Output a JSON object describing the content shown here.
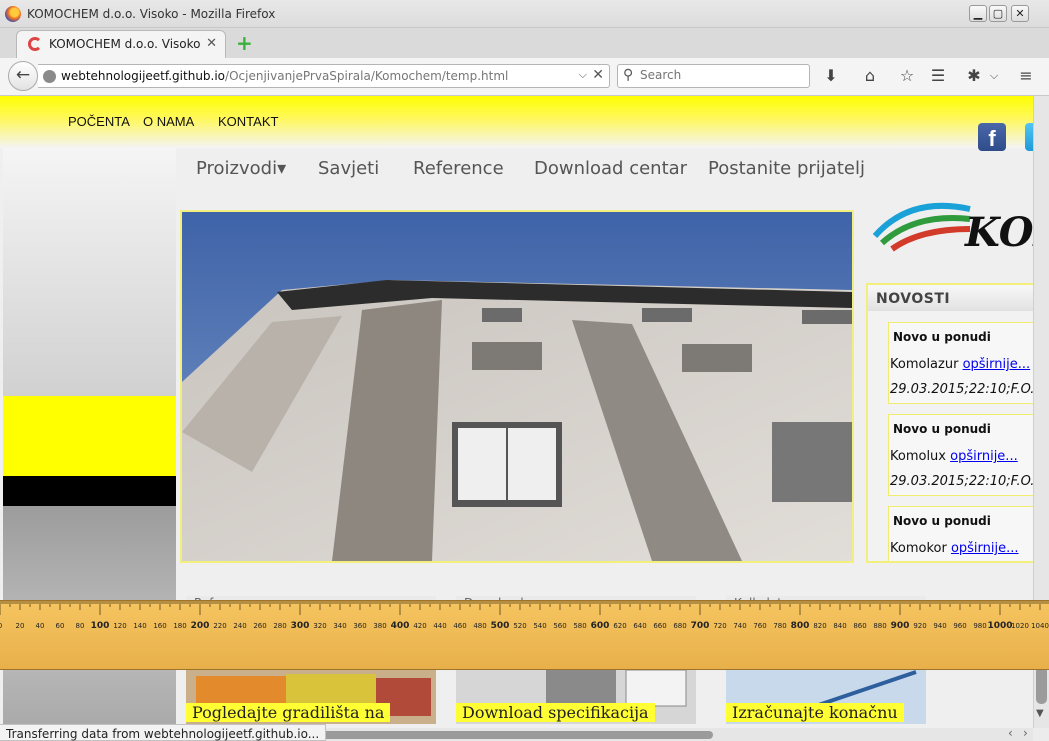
{
  "browser": {
    "window_title": "KOMOCHEM d.o.o. Visoko - Mozilla Firefox",
    "tab_title": "KOMOCHEM d.o.o. Visoko",
    "url_host": "webtehnologijeetf.github.io",
    "url_path": "/OcjenjivanjePrvaSpirala/Komochem/temp.html",
    "search_placeholder": "Search",
    "status_text": "Transferring data from webtehnologijeetf.github.io...",
    "icons": [
      "firefox-logo",
      "back-arrow",
      "globe",
      "download-arrow",
      "home",
      "star",
      "reading-list",
      "extensions",
      "menu"
    ]
  },
  "site": {
    "top_nav": [
      "POČENTA",
      "O NAMA",
      "KONTAKT"
    ],
    "main_nav": [
      "Proizvodi",
      "Savjeti",
      "Reference",
      "Download centar",
      "Postanite prijatelj"
    ],
    "dropdown_glyph": "▾",
    "news": {
      "heading": "NOVOSTI",
      "items": [
        {
          "title": "Novo u ponudi",
          "product": "Komolazur",
          "link": "opširnije...",
          "date": "29.03.2015;22:10;F.O."
        },
        {
          "title": "Novo u ponudi",
          "product": "Komolux",
          "link": "opširnije...",
          "date": "29.03.2015;22:10;F.O."
        },
        {
          "title": "Novo u ponudi",
          "product": "Komokor",
          "link": "opširnije..."
        }
      ]
    },
    "bottom_boxes": [
      {
        "label": "Reference",
        "caption": "Pogledajte gradilišta na"
      },
      {
        "label": "Download",
        "caption": "Download specifikacija"
      },
      {
        "label": "Kalkulator",
        "caption": "Izračunajte konačnu"
      }
    ],
    "logo_text": "KOM",
    "social": [
      "facebook-icon",
      "twitter-icon"
    ],
    "colors": {
      "accent_yellow": "#ffff00",
      "link_blue": "#0000ee",
      "ruler": "#f0bc58"
    }
  },
  "ruler": {
    "major_labels": [
      "100",
      "200",
      "300",
      "400",
      "500",
      "600",
      "700",
      "800",
      "900",
      "1000"
    ],
    "minor_labels": [
      "0",
      "20",
      "40",
      "60",
      "80",
      "120",
      "140",
      "160",
      "180",
      "220",
      "240",
      "260",
      "280",
      "320",
      "340",
      "360",
      "380",
      "420",
      "440",
      "460",
      "480",
      "520",
      "540",
      "560",
      "580",
      "620",
      "640",
      "660",
      "680",
      "720",
      "740",
      "760",
      "780",
      "820",
      "840",
      "860",
      "880",
      "920",
      "940",
      "960",
      "980",
      "1020",
      "1040"
    ]
  }
}
